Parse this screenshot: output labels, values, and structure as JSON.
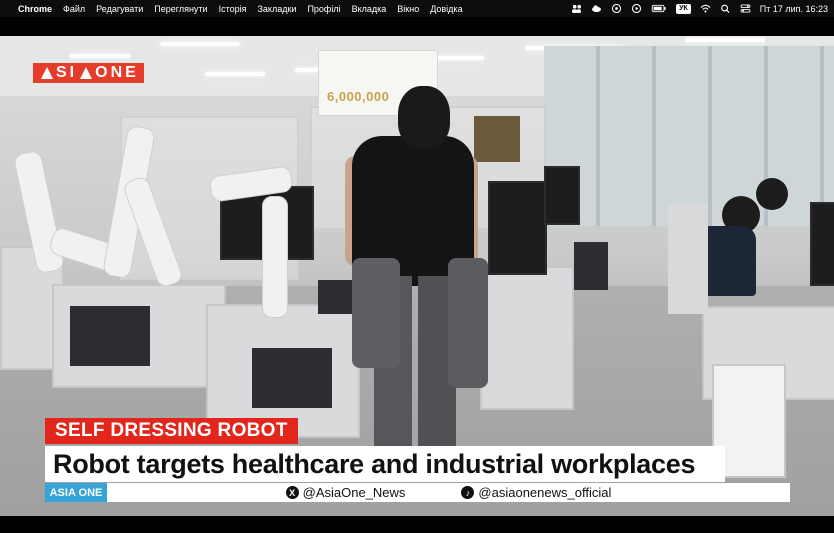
{
  "menubar": {
    "app": "Chrome",
    "items": [
      "Файл",
      "Редагувати",
      "Переглянути",
      "Історія",
      "Закладки",
      "Профілі",
      "Вкладка",
      "Вікно",
      "Довідка"
    ],
    "input_source": "УК",
    "clock": "Пт 17 лип.  16:23"
  },
  "video": {
    "logo": "ASIAONE",
    "poster_amount": "6,000,000",
    "lower_third": {
      "tag": "SELF DRESSING ROBOT",
      "headline": "Robot targets healthcare and industrial workplaces",
      "source_label": "ASIA ONE",
      "social_x": "@AsiaOne_News",
      "social_tiktok": "@asiaonenews_official"
    }
  },
  "colors": {
    "brand_red": "#e2261c",
    "source_blue": "#36a4d6"
  }
}
